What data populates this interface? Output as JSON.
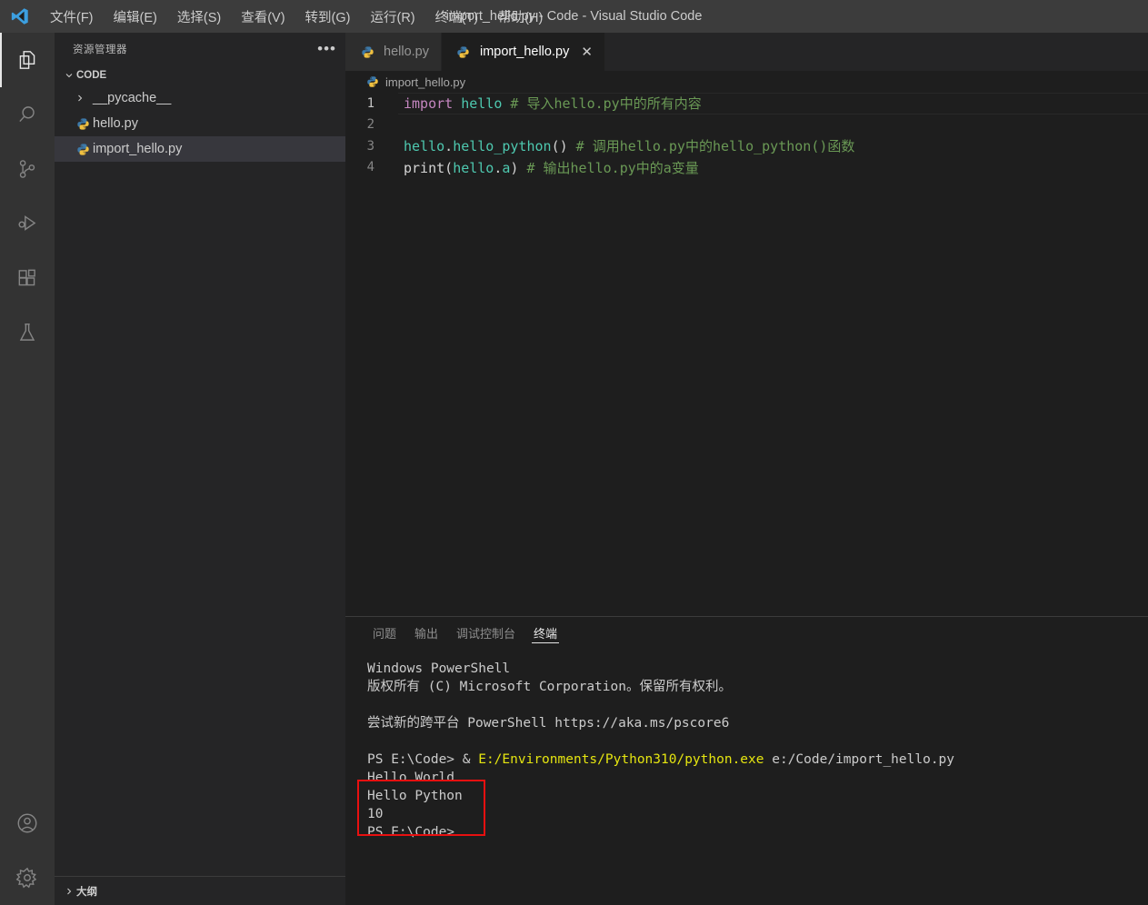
{
  "window": {
    "title": "import_hello.py - Code - Visual Studio Code",
    "logo_icon": "vscode-logo-icon"
  },
  "menubar": {
    "items": [
      {
        "label": "文件(F)",
        "name": "menu-file"
      },
      {
        "label": "编辑(E)",
        "name": "menu-edit"
      },
      {
        "label": "选择(S)",
        "name": "menu-selection"
      },
      {
        "label": "查看(V)",
        "name": "menu-view"
      },
      {
        "label": "转到(G)",
        "name": "menu-go"
      },
      {
        "label": "运行(R)",
        "name": "menu-run"
      },
      {
        "label": "终端(T)",
        "name": "menu-terminal"
      },
      {
        "label": "帮助(H)",
        "name": "menu-help"
      }
    ]
  },
  "activitybar": {
    "items": [
      {
        "icon": "explorer-files-icon",
        "active": true
      },
      {
        "icon": "search-icon",
        "active": false
      },
      {
        "icon": "source-control-icon",
        "active": false
      },
      {
        "icon": "run-and-debug-icon",
        "active": false
      },
      {
        "icon": "extensions-icon",
        "active": false
      },
      {
        "icon": "testing-flask-icon",
        "active": false
      }
    ],
    "bottom": [
      {
        "icon": "account-icon"
      },
      {
        "icon": "gear-icon"
      }
    ]
  },
  "sidebar": {
    "title": "资源管理器",
    "actions_icon": "ellipsis-icon",
    "root_folder": "CODE",
    "tree": [
      {
        "label": "__pycache__",
        "type": "folder",
        "icon": "chevron-right-icon",
        "selected": false
      },
      {
        "label": "hello.py",
        "type": "file",
        "icon": "python-file-icon",
        "selected": false
      },
      {
        "label": "import_hello.py",
        "type": "file",
        "icon": "python-file-icon",
        "selected": true
      }
    ],
    "outline_label": "大纲",
    "outline_icon": "chevron-right-icon"
  },
  "editor": {
    "tabs": [
      {
        "label": "hello.py",
        "icon": "python-file-icon",
        "active": false,
        "closable": false
      },
      {
        "label": "import_hello.py",
        "icon": "python-file-icon",
        "active": true,
        "closable": true,
        "close_icon": "close-icon"
      }
    ],
    "breadcrumb": {
      "icon": "python-file-icon",
      "label": "import_hello.py"
    },
    "lines": [
      {
        "number": "1",
        "current": true,
        "tokens": [
          {
            "t": "import",
            "c": "tok-kw"
          },
          {
            "t": " ",
            "c": "tok-plain"
          },
          {
            "t": "hello",
            "c": "tok-var"
          },
          {
            "t": " ",
            "c": "tok-plain"
          },
          {
            "t": "# 导入hello.py中的所有内容",
            "c": "tok-com"
          }
        ]
      },
      {
        "number": "2",
        "current": false,
        "tokens": []
      },
      {
        "number": "3",
        "current": false,
        "tokens": [
          {
            "t": "hello",
            "c": "tok-var"
          },
          {
            "t": ".",
            "c": "tok-plain"
          },
          {
            "t": "hello_python",
            "c": "tok-var"
          },
          {
            "t": "()",
            "c": "tok-plain"
          },
          {
            "t": " ",
            "c": "tok-plain"
          },
          {
            "t": "# 调用hello.py中的hello_python()函数",
            "c": "tok-com"
          }
        ]
      },
      {
        "number": "4",
        "current": false,
        "tokens": [
          {
            "t": "print",
            "c": "tok-plain"
          },
          {
            "t": "(",
            "c": "tok-plain"
          },
          {
            "t": "hello",
            "c": "tok-var"
          },
          {
            "t": ".",
            "c": "tok-plain"
          },
          {
            "t": "a",
            "c": "tok-var"
          },
          {
            "t": ")",
            "c": "tok-plain"
          },
          {
            "t": " ",
            "c": "tok-plain"
          },
          {
            "t": "# 输出hello.py中的a变量",
            "c": "tok-com"
          }
        ]
      }
    ]
  },
  "panel": {
    "tabs": [
      {
        "label": "问题",
        "active": false
      },
      {
        "label": "输出",
        "active": false
      },
      {
        "label": "调试控制台",
        "active": false
      },
      {
        "label": "终端",
        "active": true
      }
    ],
    "terminal": {
      "lines": [
        {
          "segments": [
            {
              "t": "Windows PowerShell",
              "c": "t-white"
            }
          ]
        },
        {
          "segments": [
            {
              "t": "版权所有 (C) Microsoft Corporation。保留所有权利。",
              "c": "t-white"
            }
          ]
        },
        {
          "segments": []
        },
        {
          "segments": [
            {
              "t": "尝试新的跨平台 PowerShell https://aka.ms/pscore6",
              "c": "t-white"
            }
          ]
        },
        {
          "segments": []
        },
        {
          "segments": [
            {
              "t": "PS E:\\Code> & ",
              "c": "t-white"
            },
            {
              "t": "E:/Environments/Python310/python.exe",
              "c": "t-yellow"
            },
            {
              "t": " e:/Code/import_hello.py",
              "c": "t-white"
            }
          ]
        },
        {
          "segments": [
            {
              "t": "Hello World",
              "c": "t-white"
            }
          ]
        },
        {
          "segments": [
            {
              "t": "Hello Python",
              "c": "t-white"
            }
          ]
        },
        {
          "segments": [
            {
              "t": "10",
              "c": "t-white"
            }
          ]
        },
        {
          "segments": [
            {
              "t": "PS E:\\Code>",
              "c": "t-white"
            }
          ]
        }
      ]
    }
  },
  "annotation": {
    "highlight_color": "#e81010",
    "name": "red-highlight-box"
  }
}
